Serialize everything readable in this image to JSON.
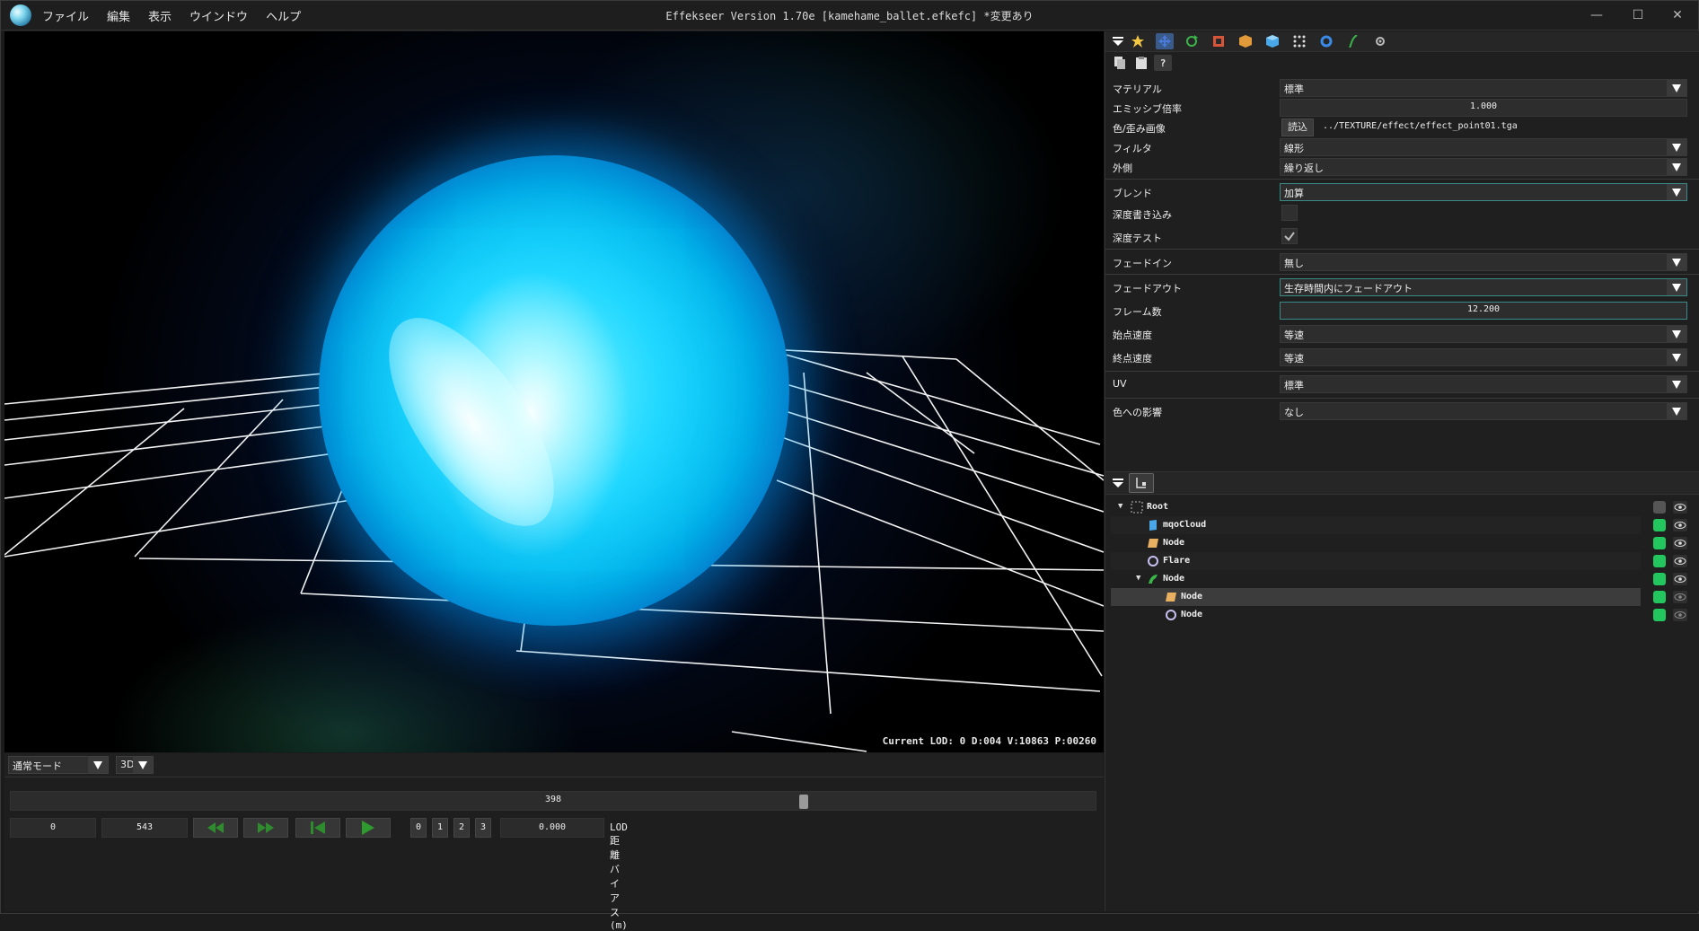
{
  "titlebar": {
    "menu": [
      "ファイル",
      "編集",
      "表示",
      "ウインドウ",
      "ヘルプ"
    ],
    "title": "Effekseer Version 1.70e [kamehame_ballet.efkefc] *変更あり",
    "controls": {
      "minimize": "—",
      "maximize": "☐",
      "close": "✕"
    }
  },
  "viewport": {
    "status": "Current LOD: 0  D:004  V:10863  P:00260"
  },
  "bottom": {
    "mode": "通常モード",
    "dim": "3D",
    "frame_current": "398",
    "frame_current_fraction": 0.733,
    "start_frame": "0",
    "end_frame": "543",
    "lod_buttons": [
      "0",
      "1",
      "2",
      "3"
    ],
    "lod_distance": "0.000",
    "lod_label": "LOD距離バイアス(m)"
  },
  "properties": {
    "material": {
      "label": "マテリアル",
      "value": "標準"
    },
    "emissive": {
      "label": "エミッシブ倍率",
      "value": "1.000"
    },
    "texture": {
      "label": "色/歪み画像",
      "button": "読込",
      "path": "../TEXTURE/effect/effect_point01.tga"
    },
    "filter": {
      "label": "フィルタ",
      "value": "線形"
    },
    "wrap": {
      "label": "外側",
      "value": "繰り返し"
    },
    "blend": {
      "label": "ブレンド",
      "value": "加算"
    },
    "depth_write": {
      "label": "深度書き込み",
      "checked": false
    },
    "depth_test": {
      "label": "深度テスト",
      "checked": true
    },
    "fade_in": {
      "label": "フェードイン",
      "value": "無し"
    },
    "fade_out": {
      "label": "フェードアウト",
      "value": "生存時間内にフェードアウト"
    },
    "frames": {
      "label": "フレーム数",
      "value": "12.200"
    },
    "start_speed": {
      "label": "始点速度",
      "value": "等速"
    },
    "end_speed": {
      "label": "終点速度",
      "value": "等速"
    },
    "uv": {
      "label": "UV",
      "value": "標準"
    },
    "color_influence": {
      "label": "色への影響",
      "value": "なし"
    }
  },
  "tree": {
    "nodes": [
      {
        "label": "Root",
        "icon": "root-icon",
        "depth": 0,
        "caret": "▼"
      },
      {
        "label": "mqoCloud",
        "icon": "model-icon",
        "depth": 1
      },
      {
        "label": "Node",
        "icon": "sprite-icon",
        "depth": 1
      },
      {
        "label": "Flare",
        "icon": "ring-icon",
        "depth": 1
      },
      {
        "label": "Node",
        "icon": "track-icon",
        "depth": 1,
        "caret": "▼"
      },
      {
        "label": "Node",
        "icon": "sprite-icon",
        "depth": 2
      },
      {
        "label": "Node",
        "icon": "ring-icon",
        "depth": 2
      }
    ]
  },
  "colors": {
    "accent_green": "#22c55e",
    "orb_cyan": "#1fd7ff",
    "panel_bg": "#1f1f1f"
  }
}
